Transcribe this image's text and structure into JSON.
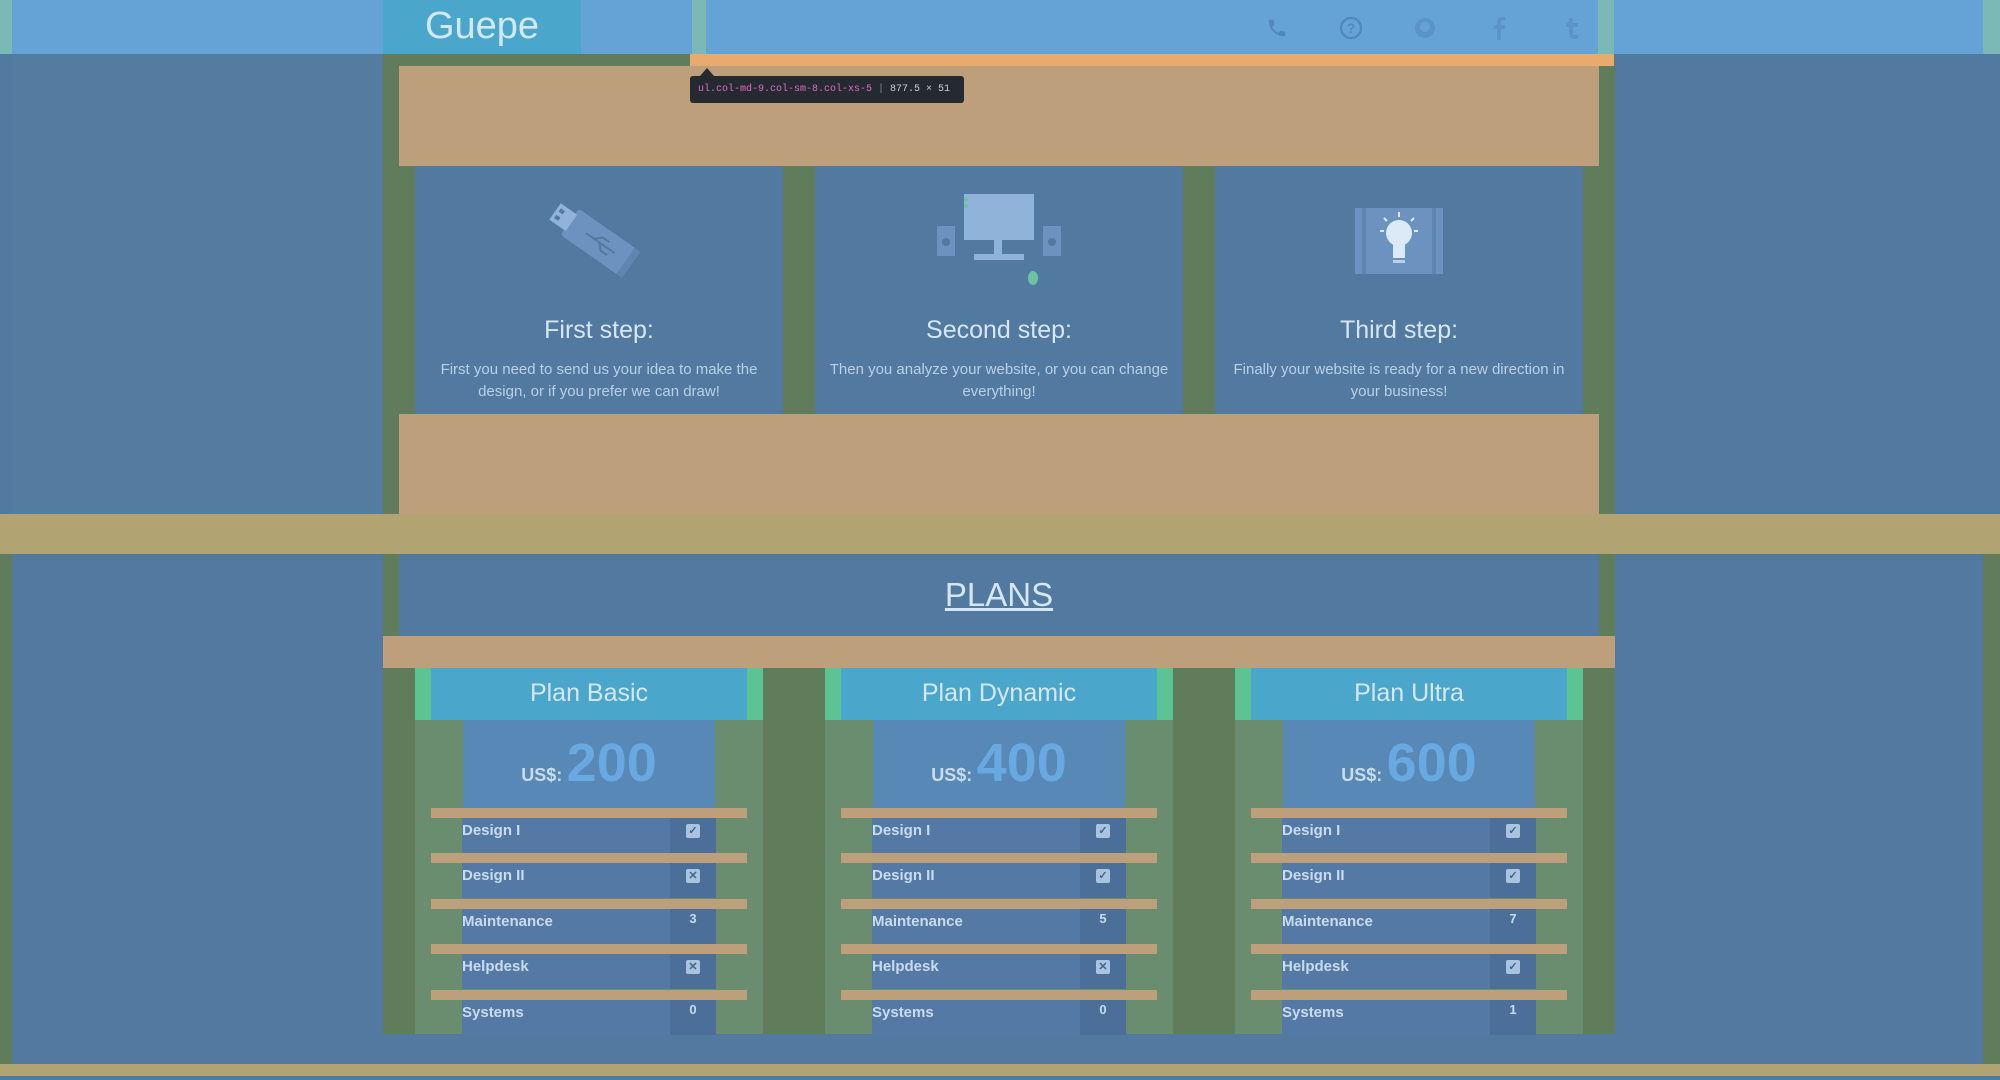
{
  "header": {
    "brand": "Guepe",
    "icons": [
      "phone-icon",
      "help-icon",
      "github-icon",
      "facebook-icon",
      "tumblr-icon"
    ]
  },
  "devtools_tooltip": {
    "selector": "ul.col-md-9.col-sm-8.col-xs-5",
    "size": "877.5 × 51"
  },
  "steps": [
    {
      "title": "First step:",
      "description": "First you need to send us your idea to make the design, or if you prefer we can draw!",
      "icon": "usb-drive-icon"
    },
    {
      "title": "Second step:",
      "description": "Then you analyze your website, or you can change everything!",
      "icon": "computer-icon"
    },
    {
      "title": "Third step:",
      "description": "Finally your website is ready for a new direction in your business!",
      "icon": "lightbulb-icon"
    }
  ],
  "plans_section": {
    "title": "PLANS"
  },
  "plans": [
    {
      "name": "Plan Basic",
      "currency": "US$:",
      "price": "200",
      "features": [
        {
          "name": "Design I",
          "type": "check",
          "value": "✓"
        },
        {
          "name": "Design II",
          "type": "check",
          "value": "✕"
        },
        {
          "name": "Maintenance",
          "type": "text",
          "value": "3"
        },
        {
          "name": "Helpdesk",
          "type": "check",
          "value": "✕"
        },
        {
          "name": "Systems",
          "type": "text",
          "value": "0"
        }
      ]
    },
    {
      "name": "Plan Dynamic",
      "currency": "US$:",
      "price": "400",
      "features": [
        {
          "name": "Design I",
          "type": "check",
          "value": "✓"
        },
        {
          "name": "Design II",
          "type": "check",
          "value": "✓"
        },
        {
          "name": "Maintenance",
          "type": "text",
          "value": "5"
        },
        {
          "name": "Helpdesk",
          "type": "check",
          "value": "✕"
        },
        {
          "name": "Systems",
          "type": "text",
          "value": "0"
        }
      ]
    },
    {
      "name": "Plan Ultra",
      "currency": "US$:",
      "price": "600",
      "features": [
        {
          "name": "Design I",
          "type": "check",
          "value": "✓"
        },
        {
          "name": "Design II",
          "type": "check",
          "value": "✓"
        },
        {
          "name": "Maintenance",
          "type": "text",
          "value": "7"
        },
        {
          "name": "Helpdesk",
          "type": "check",
          "value": "✓"
        },
        {
          "name": "Systems",
          "type": "text",
          "value": "1"
        }
      ]
    }
  ],
  "colors": {
    "content": "#52799f",
    "margin": "#be9f7c",
    "padding": "#617c5a",
    "accent": "#4aa7cb"
  }
}
